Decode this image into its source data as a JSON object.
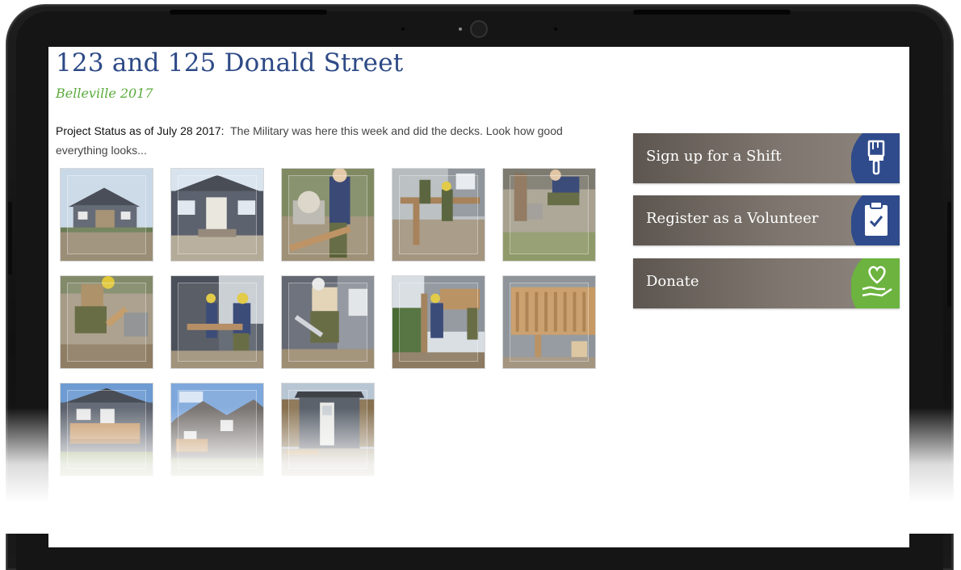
{
  "page": {
    "title": "123 and 125 Donald Street",
    "subtitle": "Belleville 2017",
    "status_label": "Project Status as of July 28 2017:",
    "status_text": "The Military was here this week and did the decks. Look how good everything looks..."
  },
  "gallery": {
    "photos": [
      {
        "name": "photo-house-front-1"
      },
      {
        "name": "photo-house-front-2"
      },
      {
        "name": "photo-mitre-saw"
      },
      {
        "name": "photo-deck-frame"
      },
      {
        "name": "photo-kneeling-worker"
      },
      {
        "name": "photo-cutting-board"
      },
      {
        "name": "photo-deck-posts"
      },
      {
        "name": "photo-hand-saw"
      },
      {
        "name": "photo-deck-build"
      },
      {
        "name": "photo-finished-deck"
      },
      {
        "name": "photo-house-rear"
      },
      {
        "name": "photo-house-side"
      },
      {
        "name": "photo-shed"
      }
    ]
  },
  "sidebar": {
    "shift_label": "Sign up for a Shift",
    "volunteer_label": "Register as a Volunteer",
    "donate_label": "Donate",
    "shift_icon": "paintbrush-icon",
    "volunteer_icon": "clipboard-check-icon",
    "donate_icon": "heart-hand-icon"
  },
  "colors": {
    "title": "#2d4a86",
    "subtitle": "#5aab3c",
    "icon_blue": "#2f4b8c",
    "icon_green": "#6cb33f",
    "cta_bg": "#6f6862"
  }
}
